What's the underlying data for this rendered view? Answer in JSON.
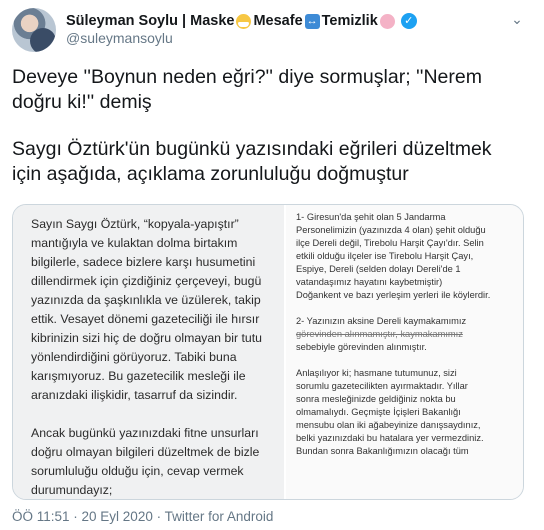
{
  "author": {
    "name": "Süleyman Soylu | Maske",
    "name_part2": "Mesafe",
    "name_part3": "Temizlik",
    "handle": "@suleymansoylu"
  },
  "tweet": {
    "paragraph1_line1": "Deveye ''Boynun neden eğri?'' diye sormuşlar; ''Nerem",
    "paragraph1_line2": "doğru ki!'' demiş",
    "paragraph2_line1": "Saygı Öztürk'ün bugünkü yazısındaki eğrileri düzeltmek",
    "paragraph2_line2": "için aşağıda, açıklama zorunluluğu doğmuştur"
  },
  "media": {
    "left_lines": [
      "Sayın Saygı Öztürk, “kopyala-yapıştır”",
      "mantığıyla ve kulaktan dolma birtakım",
      "bilgilerle, sadece bizlere karşı husumetini",
      "dillendirmek için çizdiğiniz çerçeveyi, bugü",
      "yazınızda da şaşkınlıkla ve üzülerek, takip",
      "ettik. Vesayet dönemi gazeteciliği ile hırsır",
      "kibrinizin sizi hiç de doğru olmayan bir tutu",
      "yönlendirdiğini görüyoruz. Tabiki buna",
      "karışmıyoruz. Bu gazetecilik mesleği ile",
      "aranızdaki ilişkidir, tasarruf da sizindir."
    ],
    "left_lines_2": [
      "Ancak bugünkü yazınızdaki fitne unsurları",
      "doğru olmayan bilgileri düzeltmek de bizle",
      "sorumluluğu olduğu için, cevap vermek",
      "durumundayız;"
    ],
    "right_lines_1": [
      "1- Giresun'da şehit olan  5 Jandarma",
      "Personelimizin (yazınızda 4 olan) şehit olduğu",
      "ilçe Dereli değil, Tirebolu Harşit Çayı'dır. Selin",
      "etkili olduğu ilçeler ise Tirebolu Harşit Çayı,",
      "Espiye, Dereli (selden dolayı Dereli'de 1",
      "vatandaşımız hayatını kaybetmiştir)",
      "Doğankent ve bazı yerleşim yerleri ile köylerdir."
    ],
    "right_lines_2": [
      "2- Yazınızın aksine Dereli kaymakamımız",
      "görevinden alınmamıştır, kaymakamımız",
      "sebebiyle görevinden alınmıştır."
    ],
    "right_lines_3": [
      "Anlaşılıyor ki; hasmane tutumunuz, sizi",
      "sorumlu gazetecilikten ayırmaktadır. Yıllar",
      "sonra  mesleğinizde geldiğiniz nokta bu",
      "olmamalıydı. Geçmişte İçişleri Bakanlığı",
      "mensubu olan iki ağabeyinize danışsaydınız,",
      "belki yazınızdaki bu hatalara yer vermezdiniz.",
      "Bundan sonra Bakanlığımızın olacağı tüm"
    ]
  },
  "footer": {
    "timestamp": "ÖÖ 11:51 · 20 Eyl 2020 · Twitter for Android"
  },
  "icons": {
    "verified": "verified-badge-icon",
    "menu": "chevron-down-icon"
  },
  "colors": {
    "accent": "#1da1f2",
    "muted": "#657786",
    "text": "#14171a"
  }
}
